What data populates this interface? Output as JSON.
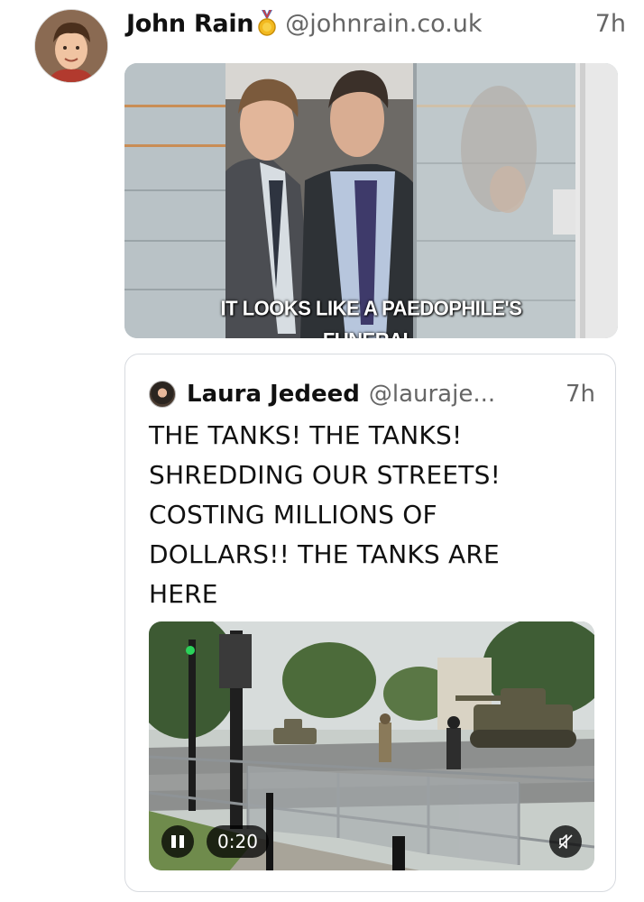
{
  "post": {
    "display_name": "John Rain",
    "badge_icon": "medal-icon",
    "handle": "@johnrain.co.uk",
    "time": "7h",
    "image_caption": [
      "IT LOOKS LIKE A PAEDOPHILE'S",
      "FUNERAL."
    ]
  },
  "quote": {
    "display_name": "Laura Jedeed",
    "handle": "@lauraje...",
    "time": "7h",
    "text": "THE TANKS! THE TANKS! SHREDDING OUR STREETS! COSTING MILLIONS OF DOLLARS!! THE TANKS ARE HERE",
    "video": {
      "duration": "0:20",
      "play_state_icon": "pause-icon",
      "audio_icon": "muted-speaker-icon"
    }
  },
  "colors": {
    "text_primary": "#111111",
    "text_secondary": "#666666",
    "card_border": "#d7dadf",
    "overlay": "#000000"
  }
}
